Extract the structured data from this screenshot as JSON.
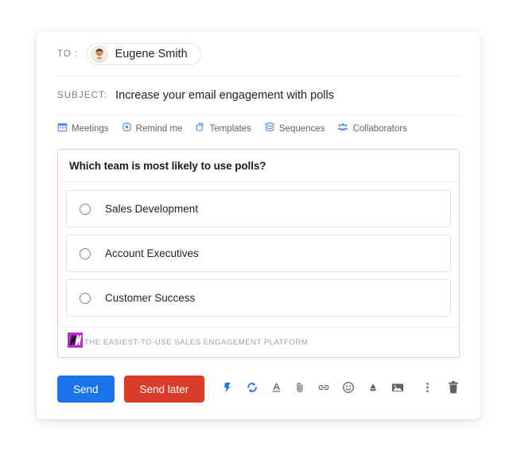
{
  "compose": {
    "to": {
      "label": "TO :",
      "recipient": "Eugene Smith",
      "avatar_icon": "user-photo-avatar"
    },
    "subject": {
      "label": "SUBJECT:",
      "value": "Increase your email engagement with polls"
    },
    "feature_bar": [
      {
        "label": "Meetings",
        "icon": "calendar-icon"
      },
      {
        "label": "Remind me",
        "icon": "clock-icon"
      },
      {
        "label": "Templates",
        "icon": "copy-layers-icon"
      },
      {
        "label": "Sequences",
        "icon": "stacked-layers-icon"
      },
      {
        "label": "Collaborators",
        "icon": "people-group-icon"
      }
    ],
    "poll": {
      "question": "Which team is most likely to use polls?",
      "options": [
        {
          "label": "Sales Development"
        },
        {
          "label": "Account Executives"
        },
        {
          "label": "Customer Success"
        }
      ],
      "footer": {
        "logo_icon": "yesware-m-logo",
        "tagline": "THE EASIEST-TO-USE SALES ENGAGEMENT PLATFORM"
      }
    },
    "actions": {
      "send_label": "Send",
      "send_later_label": "Send later",
      "tools": [
        {
          "icon": "lightning-bolt-icon"
        },
        {
          "icon": "sync-refresh-icon"
        },
        {
          "icon": "text-format-icon"
        },
        {
          "icon": "attachment-paperclip-icon"
        },
        {
          "icon": "link-icon"
        },
        {
          "icon": "emoji-smiley-icon"
        },
        {
          "icon": "google-drive-icon"
        },
        {
          "icon": "insert-image-icon"
        }
      ],
      "right_tools": [
        {
          "icon": "more-vertical-icon"
        },
        {
          "icon": "trash-delete-icon"
        }
      ]
    }
  },
  "colors": {
    "send_blue": "#1a73e8",
    "send_later_red": "#db3b2b",
    "feature_link_blue": "#5b8def",
    "poll_border": "#e9cbe9",
    "brand_magenta": "#c026d3"
  }
}
